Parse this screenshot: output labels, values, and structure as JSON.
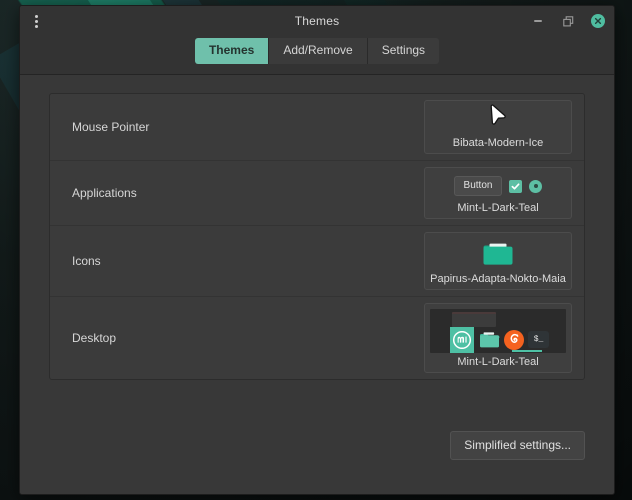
{
  "window": {
    "title": "Themes",
    "menu_icon": "kebab-menu-icon",
    "minimize_icon": "minimize-icon",
    "maximize_icon": "maximize-restore-icon",
    "close_icon": "close-icon"
  },
  "tabs": [
    {
      "label": "Themes",
      "active": true
    },
    {
      "label": "Add/Remove",
      "active": false
    },
    {
      "label": "Settings",
      "active": false
    }
  ],
  "rows": [
    {
      "label": "Mouse Pointer",
      "theme_name": "Bibata-Modern-Ice",
      "preview": "cursor-arrow-icon"
    },
    {
      "label": "Applications",
      "theme_name": "Mint-L-Dark-Teal",
      "preview": "widget-sampler",
      "widgets": {
        "button_label": "Button",
        "checkbox_checked": true,
        "radio_selected": true
      }
    },
    {
      "label": "Icons",
      "theme_name": "Papirus-Adapta-Nokto-Maia",
      "preview": "folder-icon"
    },
    {
      "label": "Desktop",
      "theme_name": "Mint-L-Dark-Teal",
      "preview": "desktop-mockup",
      "dock_icons": [
        "mint-logo-icon",
        "folder-icon",
        "firefox-icon",
        "terminal-icon"
      ],
      "terminal_prompt": "$_"
    }
  ],
  "footer": {
    "simplified_settings_label": "Simplified settings..."
  },
  "colors": {
    "accent_teal": "#6fc0ab",
    "folder_green": "#1faa86",
    "firefox_orange": "#f5621f",
    "window_bg": "#383838",
    "header_bg": "#333333",
    "row_bg": "#3b3b3b"
  }
}
